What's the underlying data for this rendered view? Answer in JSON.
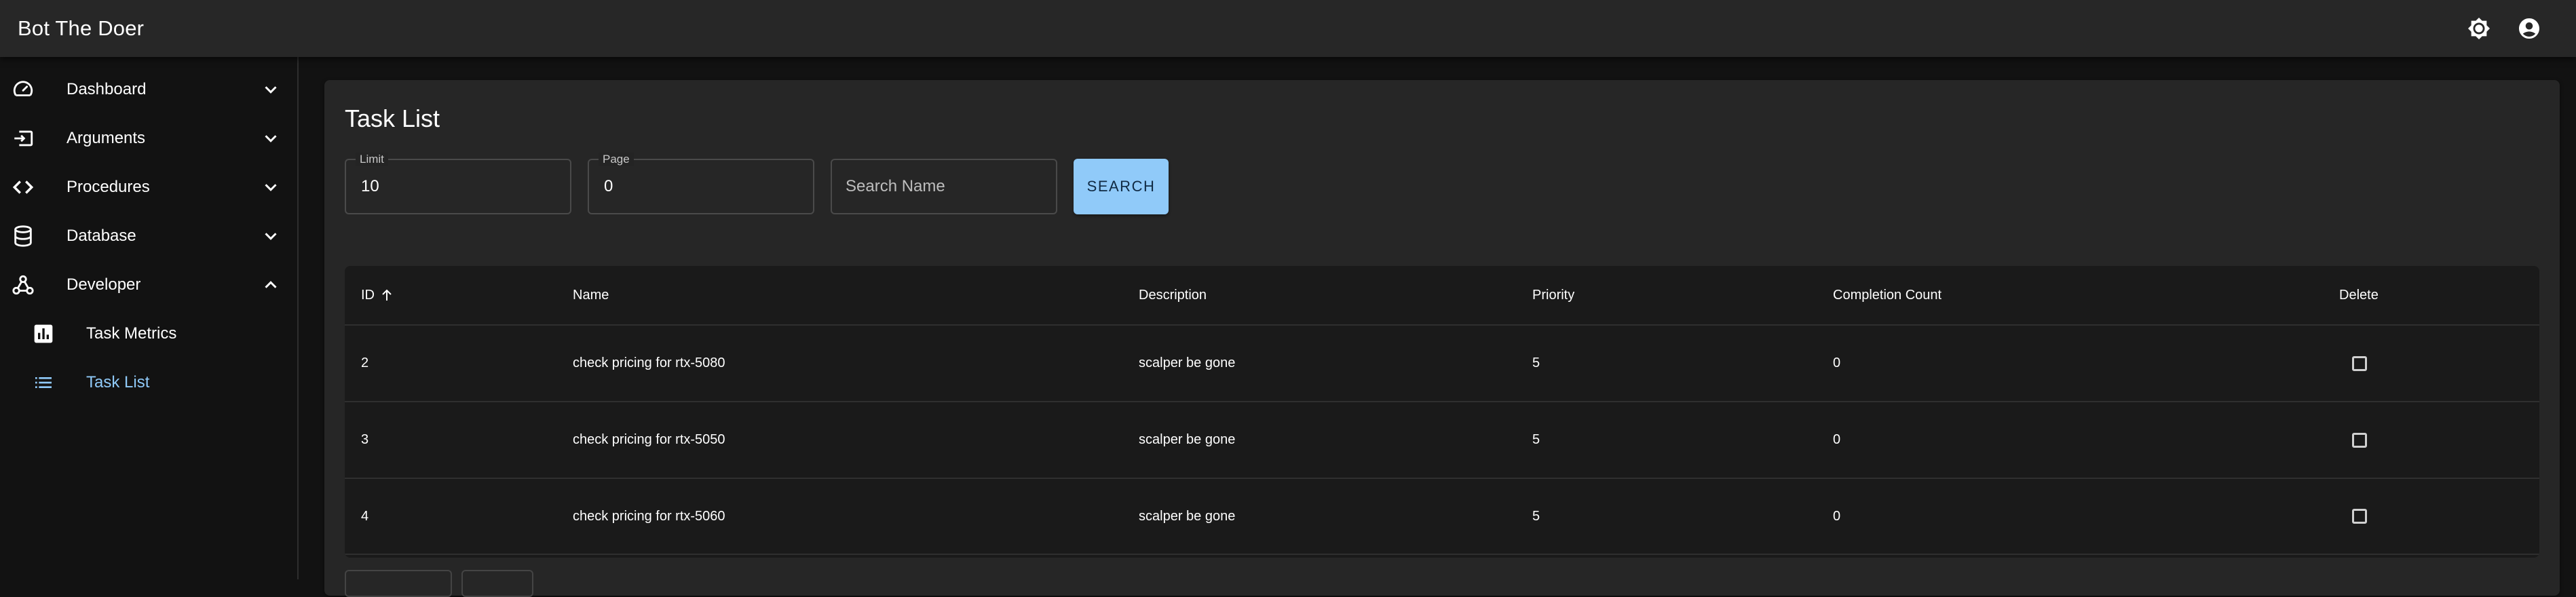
{
  "app": {
    "title": "Bot The Doer"
  },
  "header": {
    "icons": [
      "brightness-icon",
      "account-circle-icon"
    ]
  },
  "sidebar": {
    "items": [
      {
        "label": "Dashboard",
        "icon": "speedometer-icon",
        "expanded": false
      },
      {
        "label": "Arguments",
        "icon": "input-icon",
        "expanded": false
      },
      {
        "label": "Procedures",
        "icon": "code-icon",
        "expanded": false
      },
      {
        "label": "Database",
        "icon": "database-icon",
        "expanded": false
      },
      {
        "label": "Developer",
        "icon": "webhook-icon",
        "expanded": true
      }
    ],
    "subitems": [
      {
        "label": "Task Metrics",
        "icon": "bar-chart-icon",
        "active": false
      },
      {
        "label": "Task List",
        "icon": "list-icon",
        "active": true
      }
    ]
  },
  "main": {
    "title": "Task List",
    "filters": {
      "limit": {
        "label": "Limit",
        "value": "10"
      },
      "page": {
        "label": "Page",
        "value": "0"
      },
      "search": {
        "placeholder": "Search Name",
        "value": ""
      }
    },
    "search_button": "SEARCH",
    "table": {
      "columns": [
        "ID",
        "Name",
        "Description",
        "Priority",
        "Completion Count",
        "Delete"
      ],
      "sort": {
        "column": "ID",
        "direction": "ascending"
      },
      "rows": [
        {
          "id": "2",
          "name": "check pricing for rtx-5080",
          "description": "scalper be gone",
          "priority": "5",
          "completion_count": "0",
          "delete": false
        },
        {
          "id": "3",
          "name": "check pricing for rtx-5050",
          "description": "scalper be gone",
          "priority": "5",
          "completion_count": "0",
          "delete": false
        },
        {
          "id": "4",
          "name": "check pricing for rtx-5060",
          "description": "scalper be gone",
          "priority": "5",
          "completion_count": "0",
          "delete": false
        }
      ]
    }
  },
  "colors": {
    "appbar": "#272727",
    "background": "#121212",
    "accent": "#90caf9",
    "paper": "#1e1e1e"
  }
}
